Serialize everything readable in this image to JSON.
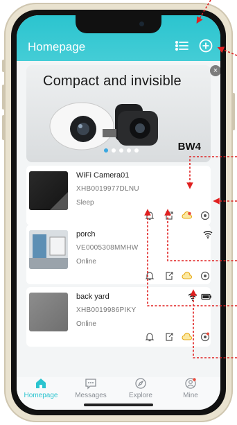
{
  "header": {
    "title": "Homepage",
    "list_icon": "list-icon",
    "add_icon": "plus-circle-icon"
  },
  "banner": {
    "headline": "Compact and invisible",
    "model": "BW4",
    "close": "×",
    "page_count": 5,
    "active_page": 1
  },
  "devices": [
    {
      "name": "WiFi Camera01",
      "serial": "XHB0019977DLNU",
      "status": "Sleep"
    },
    {
      "name": "porch",
      "serial": "VE0005308MMHW",
      "status": "Online"
    },
    {
      "name": "back yard",
      "serial": "XHB0019986PIKY",
      "status": "Online"
    }
  ],
  "tabs": [
    {
      "label": "Homepage",
      "icon": "home-icon",
      "active": true
    },
    {
      "label": "Messages",
      "icon": "chat-icon",
      "active": false
    },
    {
      "label": "Explore",
      "icon": "compass-icon",
      "active": false
    },
    {
      "label": "Mine",
      "icon": "user-icon",
      "active": false
    }
  ],
  "colors": {
    "accent": "#2bc4cf",
    "annotation": "#e02020",
    "badge": "#e84a3c"
  }
}
